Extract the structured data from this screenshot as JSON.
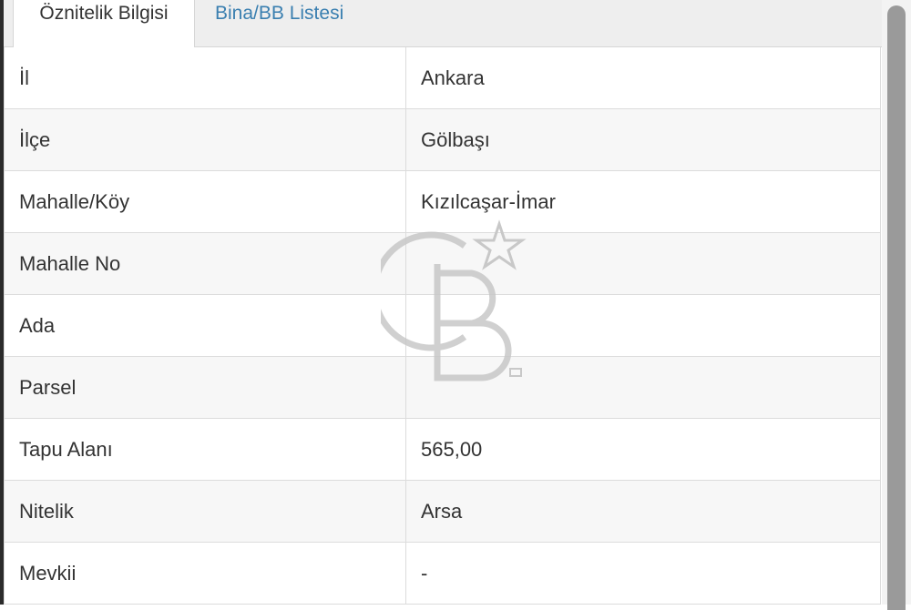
{
  "tabs": [
    {
      "label": "Öznitelik Bilgisi",
      "active": true
    },
    {
      "label": "Bina/BB Listesi",
      "active": false
    }
  ],
  "rows": [
    {
      "label": "İl",
      "value": "Ankara"
    },
    {
      "label": "İlçe",
      "value": "Gölbaşı"
    },
    {
      "label": "Mahalle/Köy",
      "value": "Kızılcaşar-İmar"
    },
    {
      "label": "Mahalle No",
      "value": ""
    },
    {
      "label": "Ada",
      "value": ""
    },
    {
      "label": "Parsel",
      "value": ""
    },
    {
      "label": "Tapu Alanı",
      "value": "565,00"
    },
    {
      "label": "Nitelik",
      "value": "Arsa"
    },
    {
      "label": "Mevkii",
      "value": "-"
    }
  ],
  "colors": {
    "tab_link": "#3a7fb0",
    "text": "#333333",
    "row_alt": "#f7f7f7",
    "border": "#dcdcdc"
  },
  "watermark": {
    "icon": "cb-logo-watermark"
  }
}
